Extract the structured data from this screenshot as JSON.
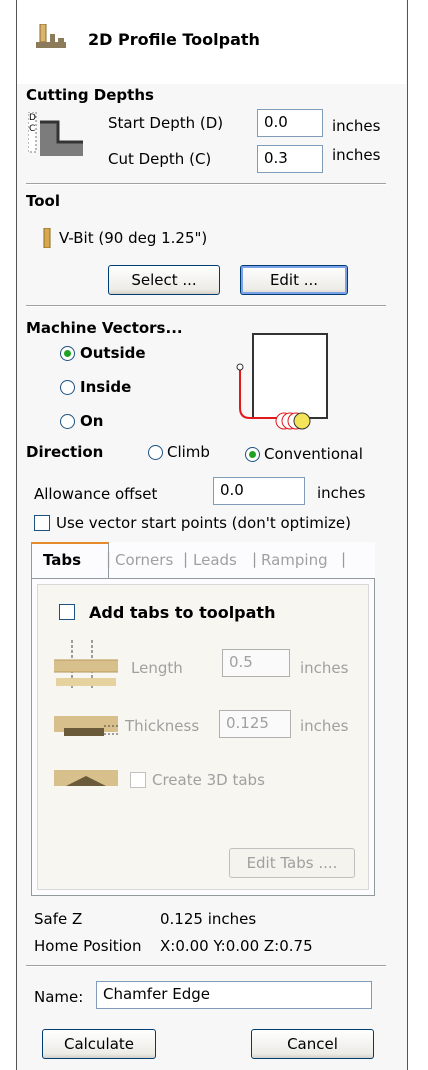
{
  "header": {
    "title": "2D Profile Toolpath",
    "icon": "profile-toolpath-icon"
  },
  "cutting_depths": {
    "heading": "Cutting Depths",
    "start_label": "Start Depth (D)",
    "start_value": "0.0",
    "cut_label": "Cut Depth (C)",
    "cut_value": "0.3",
    "unit": "inches",
    "diagram_label_d": "D",
    "diagram_label_c": "C"
  },
  "tool": {
    "heading": "Tool",
    "name": "V-Bit (90 deg 1.25\")",
    "select_label": "Select ...",
    "edit_label": "Edit ..."
  },
  "machine_vectors": {
    "heading": "Machine Vectors...",
    "options": [
      "Outside",
      "Inside",
      "On"
    ],
    "selected": "Outside"
  },
  "direction": {
    "label": "Direction",
    "climb": "Climb",
    "conventional": "Conventional",
    "selected": "Conventional"
  },
  "allowance": {
    "label": "Allowance offset",
    "value": "0.0",
    "unit": "inches"
  },
  "start_points": {
    "label": "Use vector start points (don't optimize)",
    "checked": false
  },
  "tabs": {
    "items": [
      "Tabs",
      "Corners",
      "Leads",
      "Ramping"
    ],
    "active": "Tabs",
    "add_tabs_label": "Add tabs to toolpath",
    "length_label": "Length",
    "length_value": "0.5",
    "thickness_label": "Thickness",
    "thickness_value": "0.125",
    "unit": "inches",
    "create_3d_label": "Create 3D tabs",
    "edit_tabs_label": "Edit Tabs ...."
  },
  "info": {
    "safe_z_label": "Safe Z",
    "safe_z_value": "0.125 inches",
    "home_label": "Home Position",
    "home_value": "X:0.00 Y:0.00 Z:0.75"
  },
  "name": {
    "label": "Name:",
    "value": "Chamfer Edge"
  },
  "actions": {
    "calculate_label": "Calculate",
    "cancel_label": "Cancel"
  },
  "colors": {
    "radio_selected": "#21a121",
    "tool_path_red": "#e0191b",
    "tool_yellow": "#f4e45a"
  }
}
